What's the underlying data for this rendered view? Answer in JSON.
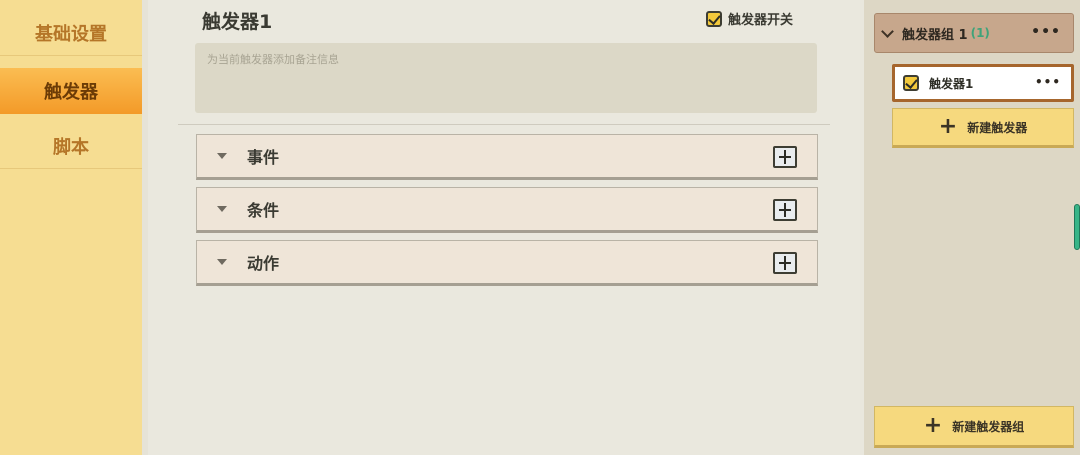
{
  "left_nav": {
    "items": [
      {
        "label": "基础设置",
        "active": false
      },
      {
        "label": "触发器",
        "active": true
      },
      {
        "label": "脚本",
        "active": false
      }
    ]
  },
  "main": {
    "title": "触发器1",
    "toggle_label": "触发器开关",
    "toggle_checked": true,
    "note_placeholder": "为当前触发器添加备注信息",
    "sections": [
      {
        "label": "事件"
      },
      {
        "label": "条件"
      },
      {
        "label": "动作"
      }
    ]
  },
  "right_panel": {
    "group": {
      "name": "触发器组 1",
      "count": "(1)"
    },
    "trigger_item": {
      "label": "触发器1",
      "checked": true
    },
    "new_trigger_label": "新建触发器",
    "new_group_label": "新建触发器组"
  },
  "colors": {
    "accent_orange": "#f39a28",
    "nav_bg": "#f6dd92",
    "count_green": "#3fa37a",
    "button_yellow": "#f6d97e"
  }
}
